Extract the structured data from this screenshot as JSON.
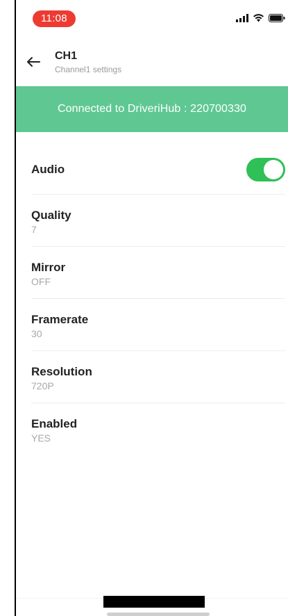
{
  "status_bar": {
    "time": "11:08",
    "time_badge_color": "#ee3b32",
    "icons": [
      "signal-icon",
      "wifi-icon",
      "battery-icon"
    ]
  },
  "app_bar": {
    "back_icon": "back-arrow-icon",
    "title": "CH1",
    "subtitle": "Channel1 settings"
  },
  "banner": {
    "text": "Connected to DriveriHub : 220700330",
    "color": "#5fc892"
  },
  "settings": {
    "audio": {
      "label": "Audio",
      "enabled": true,
      "toggle_color": "#2fc057"
    },
    "quality": {
      "label": "Quality",
      "value": "7"
    },
    "mirror": {
      "label": "Mirror",
      "value": "OFF"
    },
    "framerate": {
      "label": "Framerate",
      "value": "30"
    },
    "resolution": {
      "label": "Resolution",
      "value": "720P"
    },
    "enabled": {
      "label": "Enabled",
      "value": "YES"
    }
  }
}
